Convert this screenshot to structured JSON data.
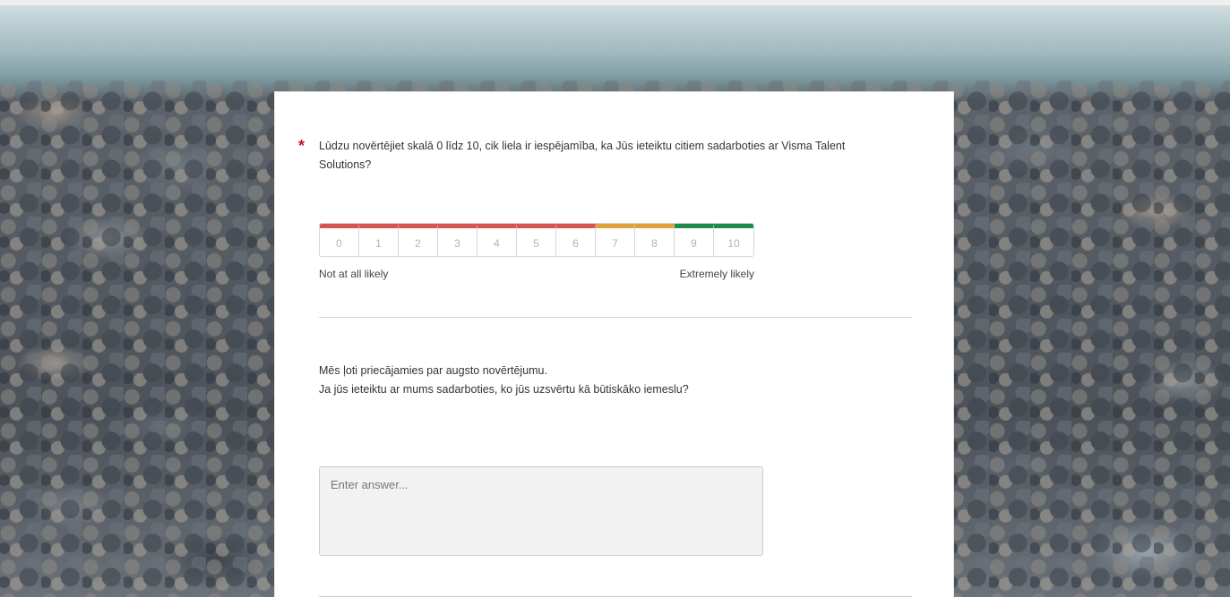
{
  "survey": {
    "question1": {
      "required_mark": "*",
      "text": "Lūdzu novērtējiet skalā 0 līdz 10, cik liela ir iespējamība, ka Jūs ieteiktu citiem sadarboties ar Visma Talent Solutions?",
      "scale_options": [
        "0",
        "1",
        "2",
        "3",
        "4",
        "5",
        "6",
        "7",
        "8",
        "9",
        "10"
      ],
      "scale_colors": {
        "detractor": "#d9534f",
        "passive": "#e0a13a",
        "promoter": "#1e8a4c"
      },
      "label_low": "Not at all likely",
      "label_high": "Extremely likely"
    },
    "question2": {
      "line1": "Mēs ļoti priecājamies par augsto novērtējumu.",
      "line2": "Ja jūs ieteiktu ar mums sadarboties, ko jūs uzsvērtu kā būtiskāko iemeslu?",
      "answer_value": "",
      "answer_placeholder": "Enter answer..."
    }
  }
}
